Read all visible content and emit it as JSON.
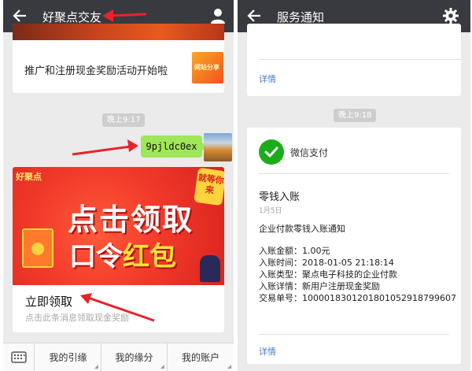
{
  "left": {
    "title": "好聚点交友",
    "promo_card": {
      "text": "推广和注册现金奖励活动开始啦",
      "thumb_text": "网站分享"
    },
    "time_pill": "晚上9:17",
    "sent_message": "9pjldc0ex",
    "redpacket_card": {
      "brand": "好聚点",
      "badge": "就等你来",
      "banner_line1": "点击领取",
      "banner_line2_a": "口令",
      "banner_line2_b": "红包",
      "cta": "立即领取",
      "cta_sub": "点击此条消息领取现金奖励"
    },
    "menu": [
      "我的引缘",
      "我的缘分",
      "我的账户"
    ]
  },
  "right": {
    "title": "服务通知",
    "card1": {
      "detail": "详情"
    },
    "time_pill": "晚上9:18",
    "card2": {
      "pay_name": "微信支付",
      "title": "零钱入账",
      "date": "1月5日",
      "intro": "企业付款零钱入账通知",
      "fields": [
        {
          "label": "入账金额：",
          "value": "1.00元"
        },
        {
          "label": "入账时间：",
          "value": "2018-01-05 21:18:14"
        },
        {
          "label": "入账类型：",
          "value": "聚点电子科技的企业付款"
        },
        {
          "label": "入账详情：",
          "value": "新用户注册现金奖励"
        },
        {
          "label": "交易单号：",
          "value": "1000018301201801052918799607"
        }
      ],
      "detail": "详情"
    }
  },
  "colors": {
    "topbar": "#393a3f",
    "bubble": "#9fe658",
    "wechat_pay": "#1aad19",
    "link": "#4a7cc0",
    "annotation_arrow": "#e8232a",
    "banner_red": "#f23a2a"
  },
  "icons": [
    "back-arrow-icon",
    "person-icon",
    "gear-icon",
    "keyboard-icon",
    "wechat-pay-icon"
  ]
}
